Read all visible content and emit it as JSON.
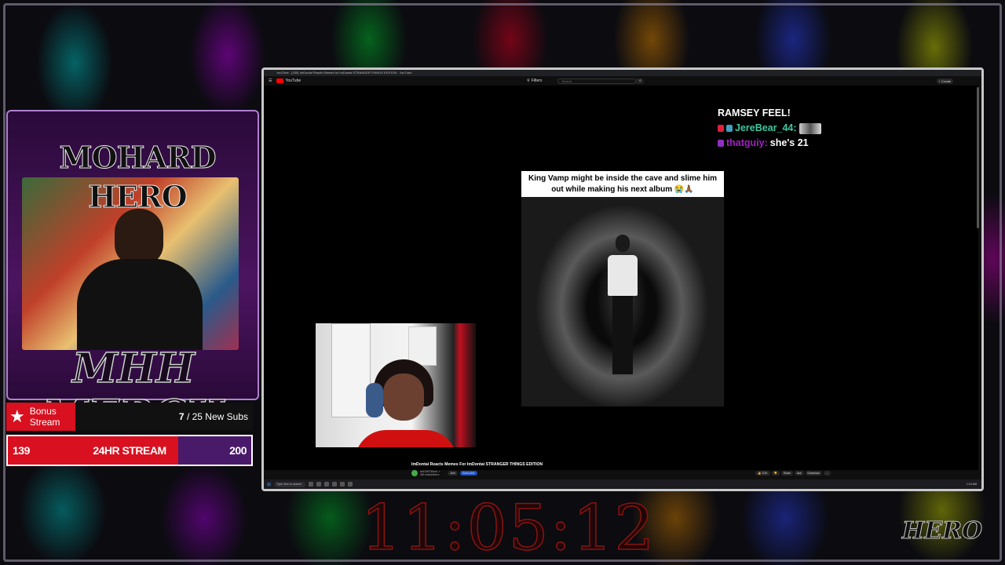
{
  "overlay": {
    "logo_text": "MOHARD HERO",
    "merch_text": "MHH MERCH",
    "timer": "11:05:12",
    "corner_logo": "HERO"
  },
  "goal_bonus": {
    "label": "Bonus Stream",
    "current": "7",
    "goal_text": "/ 25 New Subs"
  },
  "goal_stream": {
    "min": "139",
    "label": "24HR STREAM",
    "max": "200",
    "fill_fraction": 0.7
  },
  "browser": {
    "tab_title": "YouTube - (155) ImDontai Reacts Memes for ImDontai STRANGER THINGS EDITION - YouTube"
  },
  "youtube": {
    "logo": "YouTube",
    "filter": "Filters",
    "search_placeholder": "Search",
    "create": "+ Create"
  },
  "chat": {
    "header": "RAMSEY FEEL!",
    "messages": [
      {
        "user": "JereBear_44:",
        "text": ""
      },
      {
        "user": "thatguiy:",
        "text": "she's 21"
      }
    ]
  },
  "meme": {
    "caption": "King Vamp might be inside the cave and slime him out while making his next album 😭🙏🏾"
  },
  "video": {
    "title": "ImDontai Reacts Memes For ImDontai STRANGER THINGS EDITION",
    "channel": "ImDONTAIonl ✓",
    "subs": "3M subscribers",
    "join": "Join",
    "subscribe": "Subscribe",
    "actions": [
      "👍 9.2K",
      "👎",
      "Share",
      "Ask",
      "Download",
      "…"
    ]
  },
  "taskbar": {
    "search_placeholder": "Type here to search",
    "tray": "1:15 AM"
  },
  "colors": {
    "accent_red": "#d81020",
    "accent_purple": "#4a1a6a",
    "chat_user1": "#3cc8a0",
    "chat_user2": "#a020c0"
  }
}
